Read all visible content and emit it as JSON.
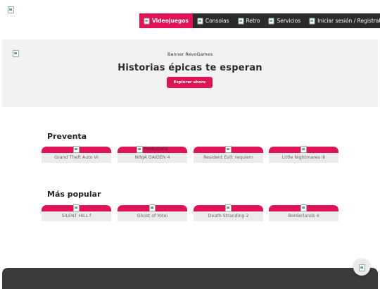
{
  "header": {
    "logo_icon": "broken-image-icon",
    "nav": [
      {
        "label": "Videojuegos",
        "active": true
      },
      {
        "label": "Consolas",
        "active": false
      },
      {
        "label": "Retro",
        "active": false
      },
      {
        "label": "Servicios",
        "active": false
      },
      {
        "label": "Iniciar sesión / Registrate",
        "active": false
      }
    ]
  },
  "hero": {
    "image_alt": "Banner RevoGames",
    "title": "Historias épicas te esperan",
    "button_label": "Explorar ahora"
  },
  "sections": [
    {
      "title": "Preventa",
      "products": [
        {
          "name": "Grand Theft Auto VI",
          "image_alt": ""
        },
        {
          "name": "NINJA GAIDEN 4",
          "image_alt": "Producto02"
        },
        {
          "name": "Resident Evil: requiem",
          "image_alt": ""
        },
        {
          "name": "Little Nightmares III",
          "image_alt": ""
        }
      ]
    },
    {
      "title": "Más popular",
      "products": [
        {
          "name": "SILENT HILL f",
          "image_alt": ""
        },
        {
          "name": "Ghost of Yotei",
          "image_alt": ""
        },
        {
          "name": "Death Stranding 2",
          "image_alt": ""
        },
        {
          "name": "Borderlands 4",
          "image_alt": ""
        }
      ]
    }
  ],
  "colors": {
    "accent": "#e01455",
    "nav_bg": "#2b2b2b",
    "hero_bg": "#f2f2f2",
    "card_label_bg": "#ececec",
    "footer_bg": "#3a3a3a"
  }
}
